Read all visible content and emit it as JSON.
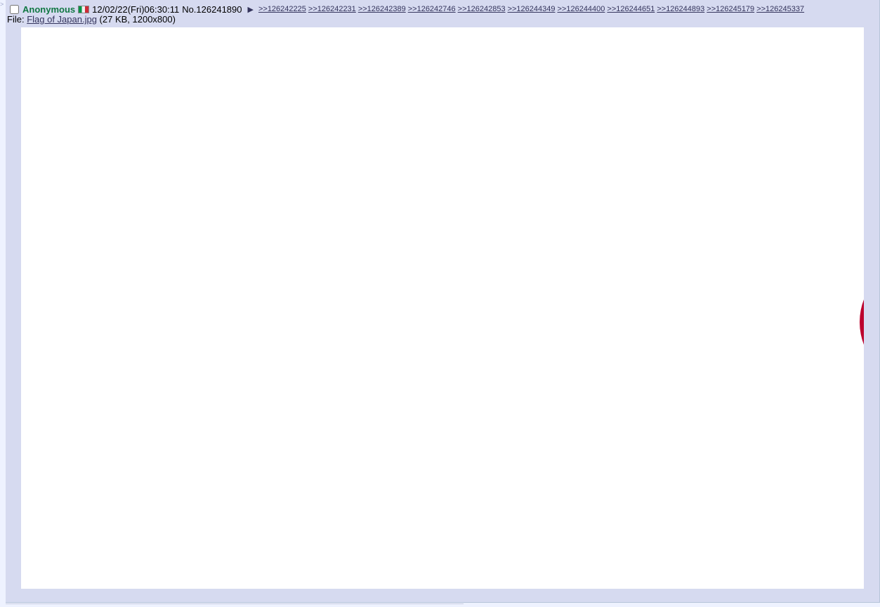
{
  "post": {
    "name": "Anonymous",
    "flag": "Italy",
    "datetime": "12/02/22(Fri)06:30:11",
    "number_prefix": "No.",
    "number": "126241890",
    "menu_icon": "triangle-right-icon",
    "backlinks": [
      ">>126242225",
      ">>126242231",
      ">>126242389",
      ">>126242746",
      ">>126242853",
      ">>126244349",
      ">>126244400",
      ">>126244651",
      ">>126244893",
      ">>126245179",
      ">>126245337"
    ],
    "file": {
      "label": "File:",
      "filename": "Flag of Japan.jpg",
      "meta": "(27 KB, 1200x800)"
    }
  },
  "colors": {
    "post_bg": "#d6daf0",
    "name": "#117743",
    "link": "#34345c",
    "flag_red": "#bc002d"
  }
}
